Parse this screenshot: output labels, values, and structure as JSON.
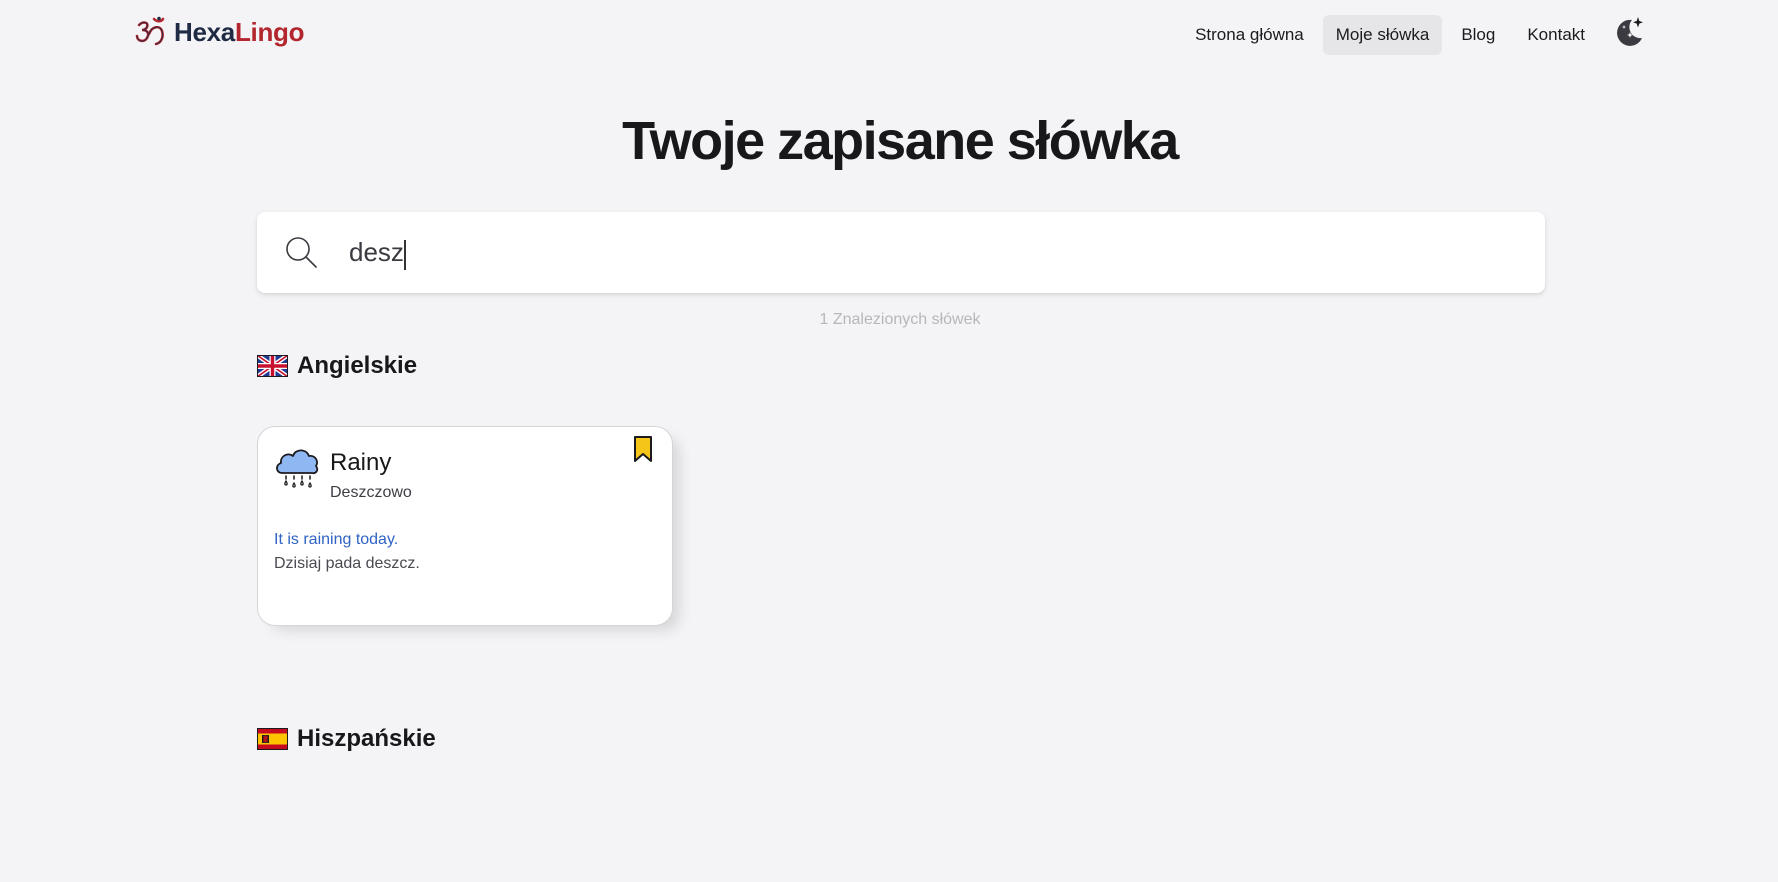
{
  "app": {
    "logo_part1": "Hexa",
    "logo_part2": "Lingo",
    "colors": {
      "brand_dark": "#1f2a44",
      "brand_red": "#b3262d",
      "link_blue": "#2f63c4",
      "bookmark": "#f5c518"
    }
  },
  "nav": {
    "items": [
      {
        "label": "Strona główna",
        "active": false
      },
      {
        "label": "Moje słówka",
        "active": true
      },
      {
        "label": "Blog",
        "active": false
      },
      {
        "label": "Kontakt",
        "active": false
      }
    ],
    "theme_icon": "moon-stars-icon"
  },
  "main": {
    "title": "Twoje zapisane słówka",
    "search": {
      "value": "desz",
      "icon": "search-icon"
    },
    "result_count": "1 Znalezionych słówek"
  },
  "sections": [
    {
      "label": "Angielskie",
      "flag_icon": "uk-flag-icon",
      "cards": [
        {
          "icon": "rain-cloud-icon",
          "word": "Rainy",
          "translation": "Deszczowo",
          "example": "It is raining today.",
          "example_translation": "Dzisiaj pada deszcz.",
          "bookmarked": true
        }
      ]
    },
    {
      "label": "Hiszpańskie",
      "flag_icon": "spain-flag-icon",
      "cards": []
    }
  ]
}
